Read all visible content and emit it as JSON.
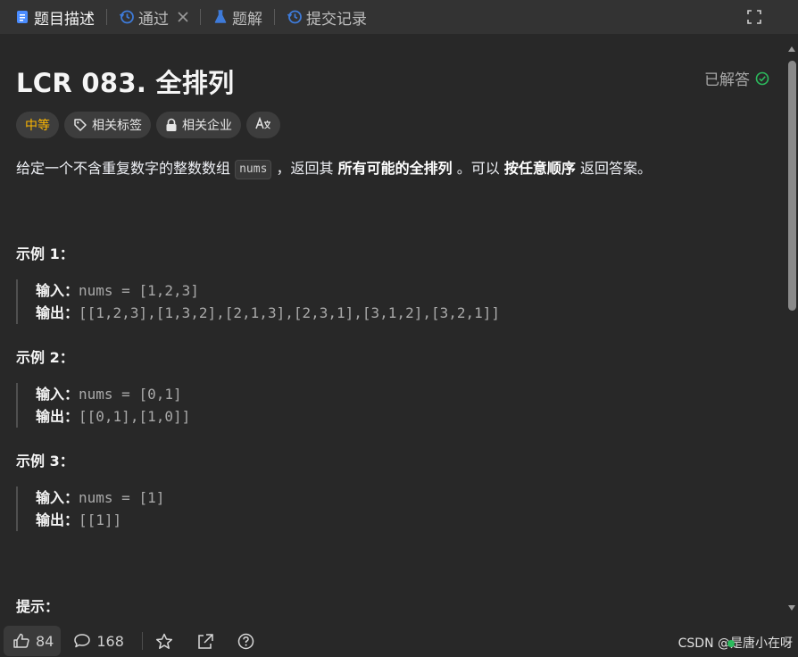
{
  "tabs": [
    {
      "label": "题目描述",
      "icon": "document-icon"
    },
    {
      "label": "通过",
      "icon": "history-icon"
    },
    {
      "label": "题解",
      "icon": "flask-icon"
    },
    {
      "label": "提交记录",
      "icon": "history-icon"
    }
  ],
  "problem": {
    "title": "LCR 083. 全排列",
    "status": "已解答",
    "tags": {
      "difficulty": "中等",
      "related_tags": "相关标签",
      "related_companies": "相关企业"
    },
    "description": {
      "part1": "给定一个不含重复数字的整数数组",
      "code": "nums",
      "part2": "，返回其",
      "bold1": "所有可能的全排列",
      "part3": "。可以",
      "bold2": "按任意顺序",
      "part4": "返回答案。"
    },
    "examples": [
      {
        "title": "示例 1：",
        "input_label": "输入：",
        "input": "nums = [1,2,3]",
        "output_label": "输出：",
        "output": "[[1,2,3],[1,3,2],[2,1,3],[2,3,1],[3,1,2],[3,2,1]]"
      },
      {
        "title": "示例 2：",
        "input_label": "输入：",
        "input": "nums = [0,1]",
        "output_label": "输出：",
        "output": "[[0,1],[1,0]]"
      },
      {
        "title": "示例 3：",
        "input_label": "输入：",
        "input": "nums = [1]",
        "output_label": "输出：",
        "output": "[[1]]"
      }
    ],
    "hint_title": "提示："
  },
  "footer": {
    "likes": "84",
    "comments": "168",
    "watermark": "CSDN @是唐小在呀"
  },
  "colors": {
    "background": "#282828",
    "tabbar": "#333333",
    "difficulty_medium": "#ffb800",
    "solved_check": "#2cbb5d"
  }
}
